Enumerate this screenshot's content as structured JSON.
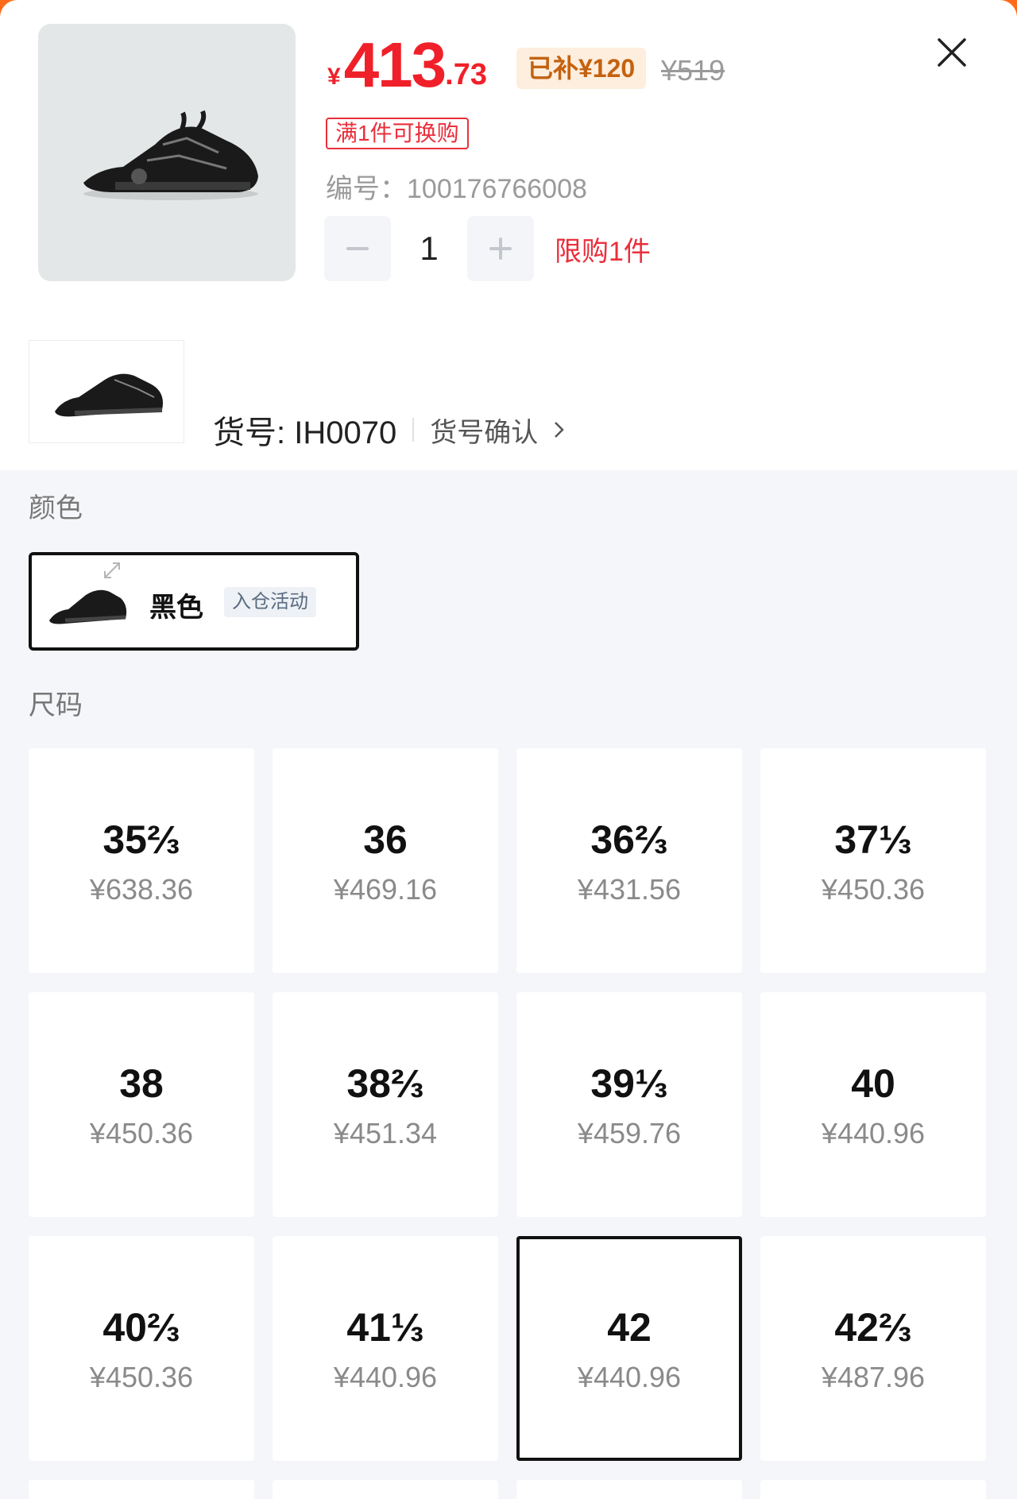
{
  "header": {
    "price": {
      "currency": "¥",
      "integer": "413",
      "decimal": ".73"
    },
    "subsidy_label": "已补¥120",
    "original_price": "¥519",
    "promo_tag": "满1件可换购",
    "sku_number": "编号：100176766008",
    "quantity": {
      "value": "1",
      "limit_text": "限购1件"
    },
    "article_number": "货号: IH0070",
    "article_confirm": "货号确认"
  },
  "colors": {
    "label": "颜色",
    "options": [
      {
        "name": "黑色",
        "badge": "入仓活动",
        "selected": true
      }
    ]
  },
  "sizes": {
    "label": "尺码",
    "selected_index": 10,
    "items": [
      {
        "label": "35⅔",
        "price": "¥638.36"
      },
      {
        "label": "36",
        "price": "¥469.16"
      },
      {
        "label": "36⅔",
        "price": "¥431.56"
      },
      {
        "label": "37⅓",
        "price": "¥450.36"
      },
      {
        "label": "38",
        "price": "¥450.36"
      },
      {
        "label": "38⅔",
        "price": "¥451.34"
      },
      {
        "label": "39⅓",
        "price": "¥459.76"
      },
      {
        "label": "40",
        "price": "¥440.96"
      },
      {
        "label": "40⅔",
        "price": "¥450.36"
      },
      {
        "label": "41⅓",
        "price": "¥440.96"
      },
      {
        "label": "42",
        "price": "¥440.96"
      },
      {
        "label": "42⅔",
        "price": "¥487.96"
      }
    ]
  },
  "theme": {
    "price_red": "#f0202a",
    "accent_orange": "#ff6a1a",
    "subsidy_bg": "#fdeede"
  }
}
